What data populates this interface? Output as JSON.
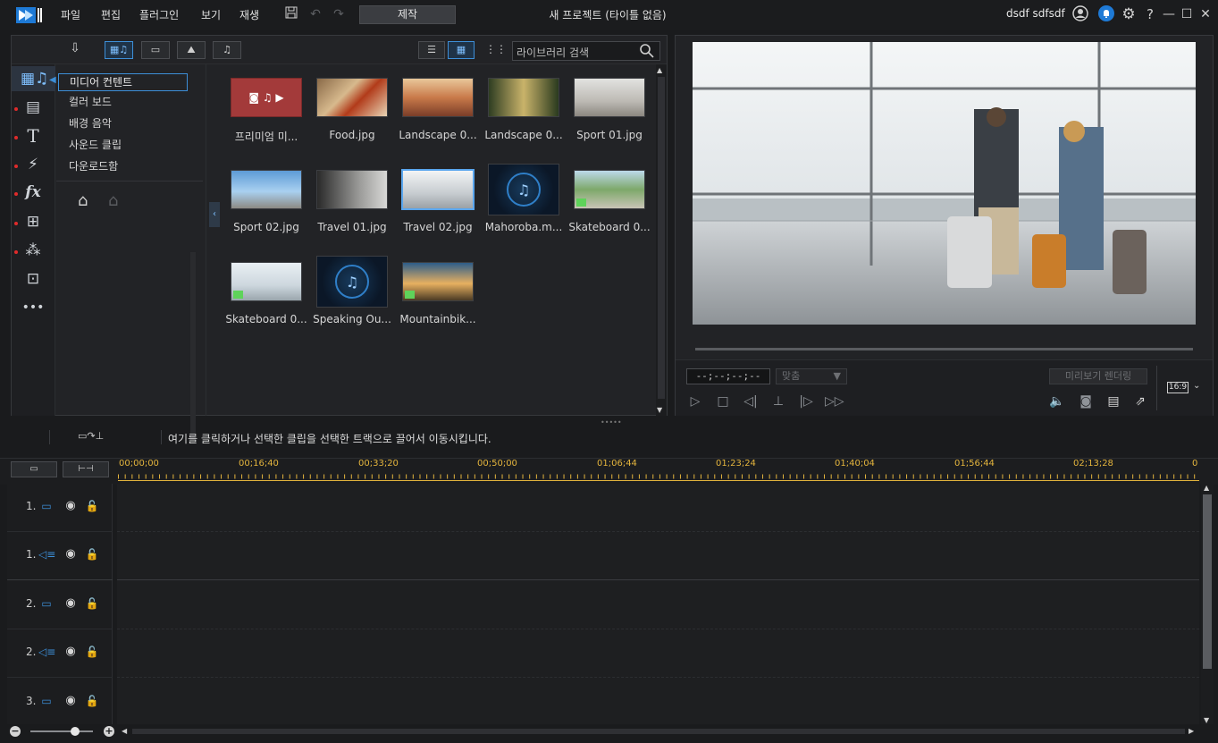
{
  "menu": [
    "파일",
    "편집",
    "플러그인",
    "보기",
    "재생"
  ],
  "produce_label": "제작",
  "project_title": "새 프로젝트 (타이틀 없음)",
  "username": "dsdf sdfsdf",
  "library": {
    "search_placeholder": "라이브러리 검색",
    "categories": [
      "미디어 컨텐트",
      "컬러 보드",
      "배경 음악",
      "사운드 클립",
      "다운로드함"
    ],
    "media": [
      {
        "label": "프리미엄 미..."
      },
      {
        "label": "Food.jpg"
      },
      {
        "label": "Landscape 0..."
      },
      {
        "label": "Landscape 0..."
      },
      {
        "label": "Sport 01.jpg"
      },
      {
        "label": "Sport 02.jpg"
      },
      {
        "label": "Travel 01.jpg"
      },
      {
        "label": "Travel 02.jpg"
      },
      {
        "label": "Mahoroba.m..."
      },
      {
        "label": "Skateboard 0..."
      },
      {
        "label": "Skateboard 0..."
      },
      {
        "label": "Speaking Ou..."
      },
      {
        "label": "Mountainbik..."
      }
    ]
  },
  "preview": {
    "timecode": "--;--;--;--",
    "fit_label": "맞춤",
    "render_label": "미리보기 렌더링",
    "aspect": "16:9"
  },
  "timeline": {
    "instruction": "여기를 클릭하거나 선택한 클립을 선택한 트랙으로 끌어서 이동시킵니다.",
    "ruler": [
      "00;00;00",
      "00;16;40",
      "00;33;20",
      "00;50;00",
      "01;06;44",
      "01;23;24",
      "01;40;04",
      "01;56;44",
      "02;13;28",
      "0"
    ],
    "tracks": [
      {
        "num": "1.",
        "type": "video"
      },
      {
        "num": "1.",
        "type": "audio"
      },
      {
        "num": "2.",
        "type": "video"
      },
      {
        "num": "2.",
        "type": "audio"
      },
      {
        "num": "3.",
        "type": "video"
      }
    ]
  },
  "colors": {
    "accent": "#3d8fd8",
    "ruler": "#e3b43d",
    "record_dot": "#e02b2b"
  }
}
